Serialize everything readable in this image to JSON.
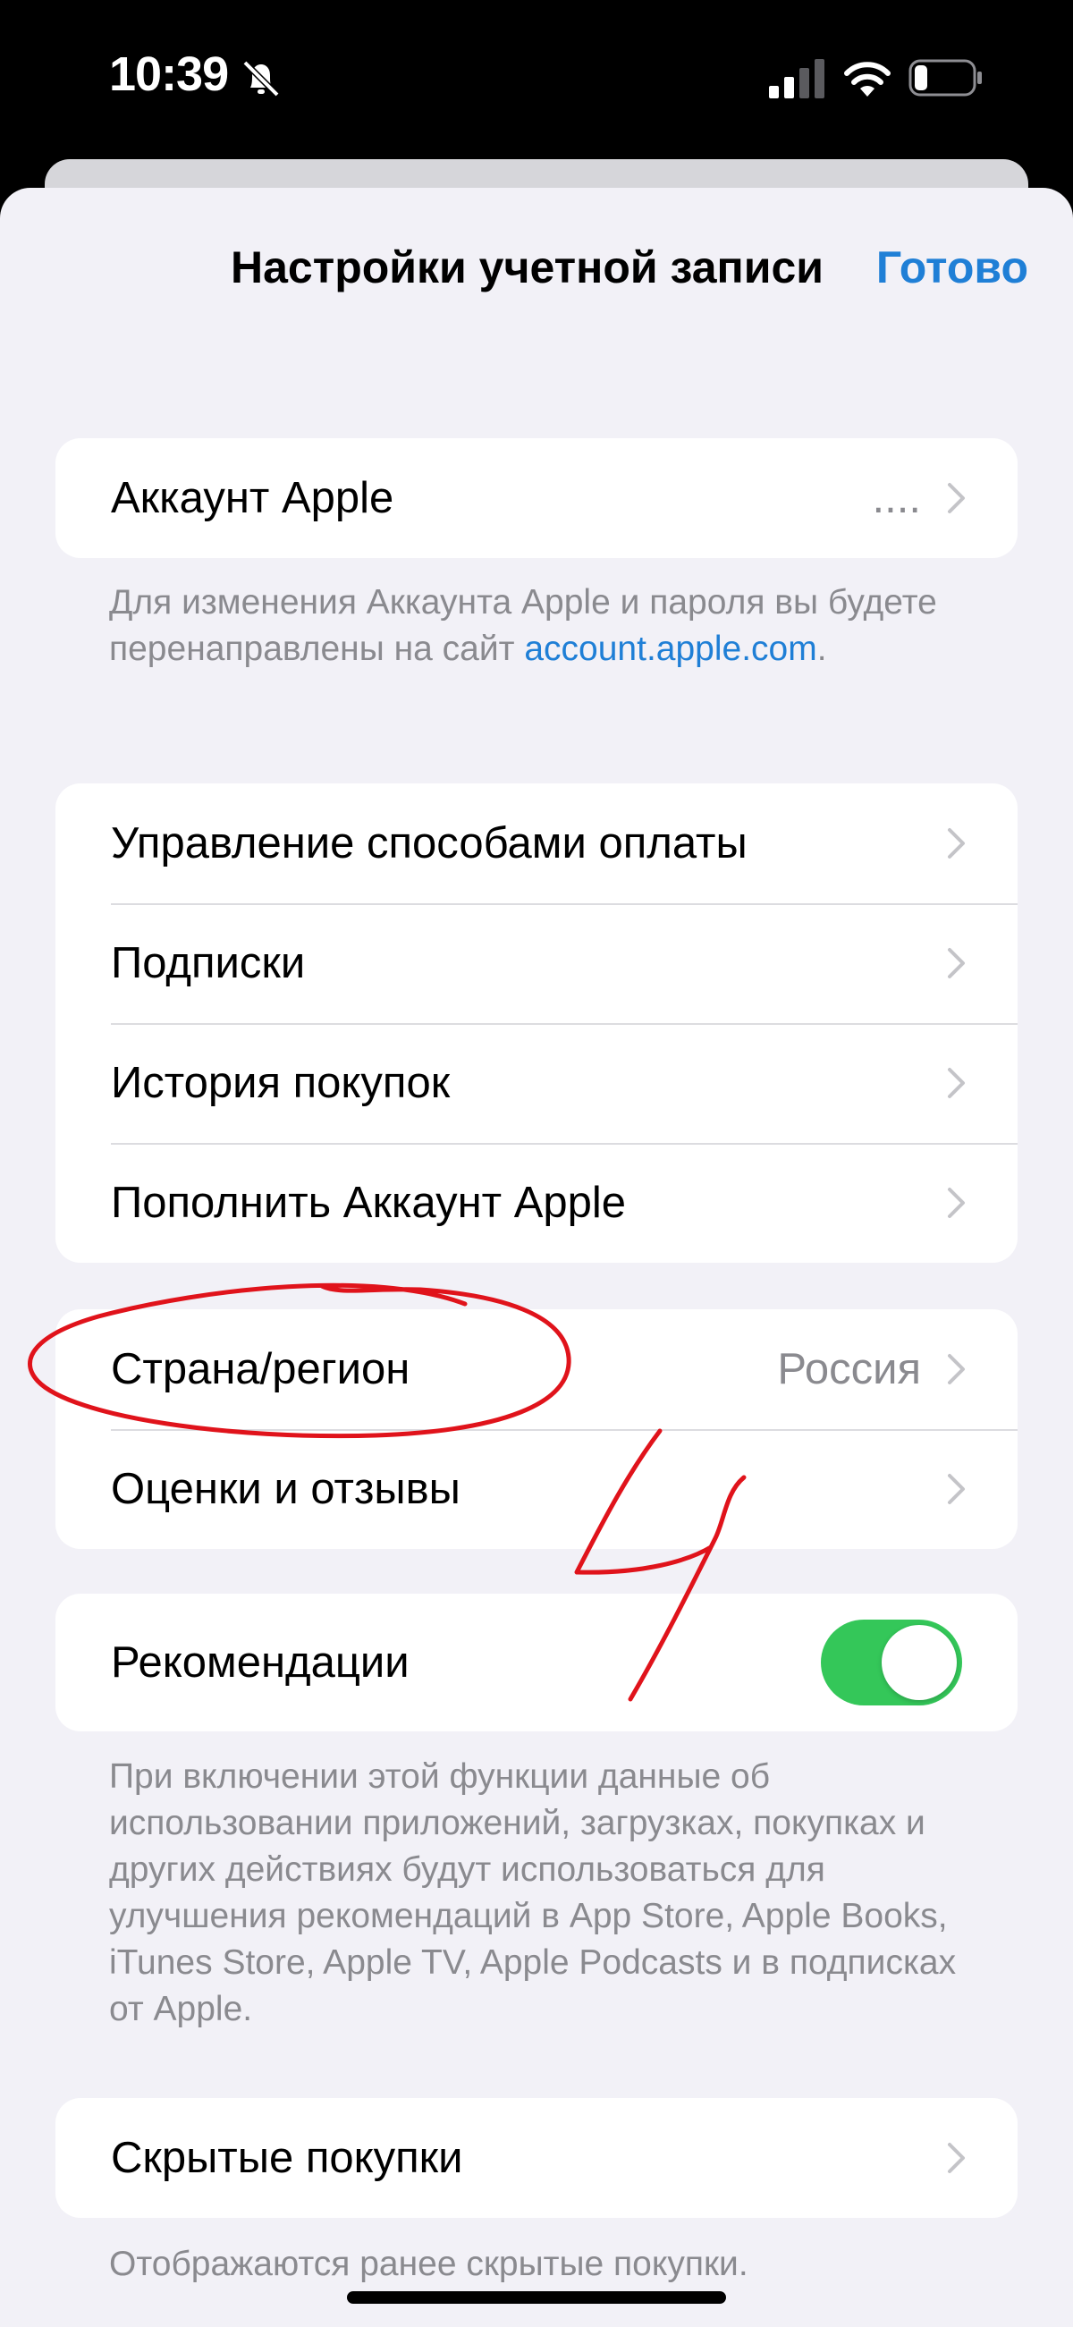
{
  "status_bar": {
    "time": "10:39",
    "icons": [
      "bell-slash-icon",
      "cellular-signal-icon",
      "wifi-icon",
      "battery-icon"
    ]
  },
  "nav": {
    "title": "Настройки учетной записи",
    "done_label": "Готово"
  },
  "apple_account": {
    "label": "Аккаунт Apple",
    "value": "....",
    "footer_text": "Для изменения Аккаунта Apple и пароля вы будете перенаправлены на сайт",
    "footer_link": "account.apple.com",
    "footer_period": "."
  },
  "purchases_group": {
    "items": [
      {
        "label": "Управление способами оплаты"
      },
      {
        "label": "Подписки"
      },
      {
        "label": "История покупок"
      },
      {
        "label": "Пополнить Аккаунт Apple"
      }
    ]
  },
  "region_group": {
    "country_label": "Страна/регион",
    "country_value": "Россия",
    "ratings_label": "Оценки и отзывы"
  },
  "recommendations": {
    "label": "Рекомендации",
    "enabled": true,
    "footer_text": "При включении этой функции данные об использовании приложений, загрузках, покупках и других действиях будут использоваться для улучшения рекомендаций в App Store, Apple Books, iTunes Store, Apple TV, Apple Podcasts и в подписках от Apple."
  },
  "hidden_purchases": {
    "label": "Скрытые покупки",
    "footer_text": "Отображаются ранее скрытые покупки."
  },
  "colors": {
    "accent": "#1f7fd6",
    "toggle_on": "#34c759",
    "annotation": "#e0131b",
    "background": "#f2f1f7"
  },
  "annotation": {
    "handwritten_mark": "4"
  }
}
